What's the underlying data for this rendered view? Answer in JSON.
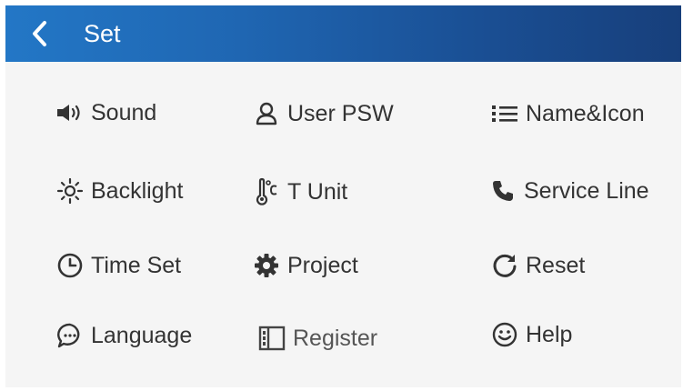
{
  "header": {
    "title": "Set",
    "back_icon": "chevron-left-icon"
  },
  "menu": [
    {
      "label": "Sound",
      "icon": "speaker-icon"
    },
    {
      "label": "User PSW",
      "icon": "user-icon"
    },
    {
      "label": "Name&Icon",
      "icon": "list-icon"
    },
    {
      "label": "Backlight",
      "icon": "brightness-icon"
    },
    {
      "label": "T Unit",
      "icon": "thermometer-icon"
    },
    {
      "label": "Service Line",
      "icon": "phone-icon"
    },
    {
      "label": "Time Set",
      "icon": "clock-icon"
    },
    {
      "label": "Project",
      "icon": "gear-icon"
    },
    {
      "label": "Reset",
      "icon": "reset-icon"
    },
    {
      "label": "Language",
      "icon": "chat-bubble-icon"
    },
    {
      "label": "Register",
      "icon": "register-icon"
    },
    {
      "label": "Help",
      "icon": "smiley-icon"
    }
  ],
  "colors": {
    "header_start": "#2377c6",
    "header_end": "#173f7b",
    "background": "#f5f5f5",
    "text": "#333333"
  }
}
